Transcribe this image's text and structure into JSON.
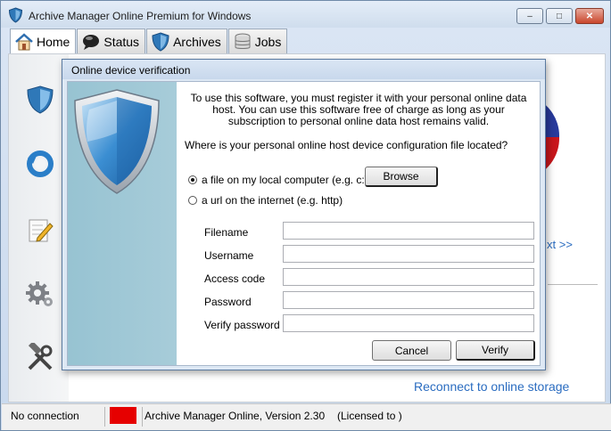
{
  "window": {
    "title": "Archive Manager Online Premium for Windows",
    "controls": {
      "minimize": "‒",
      "maximize": "□",
      "close": "✕"
    }
  },
  "tabs": [
    {
      "label": "Home",
      "icon": "home-icon",
      "active": true
    },
    {
      "label": "Status",
      "icon": "status-bubble-icon",
      "active": false
    },
    {
      "label": "Archives",
      "icon": "shield-icon",
      "active": false
    },
    {
      "label": "Jobs",
      "icon": "database-icon",
      "active": false
    }
  ],
  "sidebar": {
    "icons": [
      "shield-icon",
      "refresh-icon",
      "edit-icon",
      "gear-icon",
      "tools-icon"
    ]
  },
  "background": {
    "next_link": "xt >>",
    "reconnect_link": "Reconnect to online storage"
  },
  "dialog": {
    "title": "Online device verification",
    "intro": "To use this software, you must register it with your personal online data host.  You can use this software free of charge as long as your subscription to personal online data host remains valid.",
    "question": "Where is your personal online host device configuration file located?",
    "options": [
      {
        "label": "a file on my local computer (e.g. c:\\)",
        "selected": true
      },
      {
        "label": "a url on the internet (e.g. http)",
        "selected": false
      }
    ],
    "browse_label": "Browse",
    "fields": [
      {
        "label": "Filename",
        "value": ""
      },
      {
        "label": "Username",
        "value": ""
      },
      {
        "label": "Access code",
        "value": ""
      },
      {
        "label": "Password",
        "value": ""
      },
      {
        "label": "Verify password",
        "value": ""
      }
    ],
    "cancel_label": "Cancel",
    "verify_label": "Verify"
  },
  "statusbar": {
    "connection": "No connection",
    "indicator_color": "#e60000",
    "app_version": "Archive Manager Online, Version 2.30",
    "license": "(Licensed to )"
  },
  "colors": {
    "link": "#2a6cc0",
    "dialog_panel": "#a7ccd9",
    "shield": "#2f78b8"
  }
}
